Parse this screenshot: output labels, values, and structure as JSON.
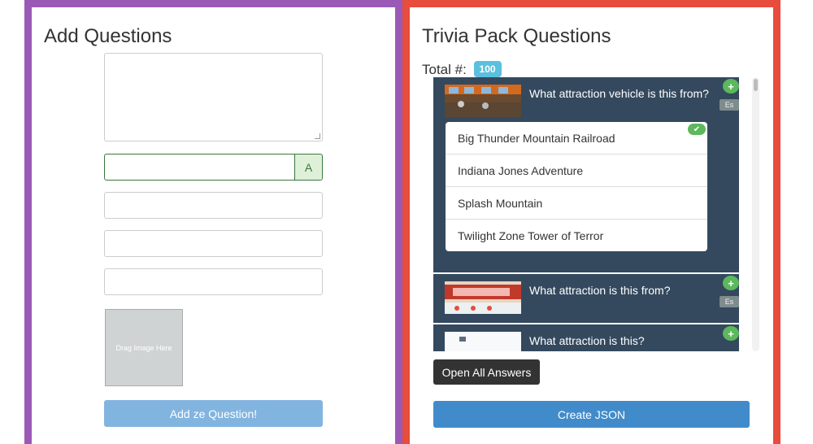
{
  "add_panel": {
    "title": "Add Questions",
    "answer_a_addon": "A",
    "drop_zone_label": "Drag Image Here",
    "add_button_label": "Add ze Question!",
    "accent_color": "#9b59b6"
  },
  "pack_panel": {
    "title": "Trivia Pack Questions",
    "total_label": "Total #:",
    "total_count": "100",
    "accent_color": "#e74c3c",
    "questions": [
      {
        "text": "What attraction vehicle is this from?",
        "plus": "+",
        "lang_badge": "Es",
        "answers": [
          {
            "label": "Big Thunder Mountain Railroad",
            "correct": true
          },
          {
            "label": "Indiana Jones Adventure"
          },
          {
            "label": "Splash Mountain"
          },
          {
            "label": "Twilight Zone Tower of Terror"
          }
        ],
        "check_icon": "✔"
      },
      {
        "text": "What attraction is this from?",
        "plus": "+",
        "lang_badge": "Es"
      },
      {
        "text": "What attraction is this?",
        "plus": "+"
      }
    ],
    "open_answers_label": "Open All Answers",
    "create_json_label": "Create JSON"
  }
}
